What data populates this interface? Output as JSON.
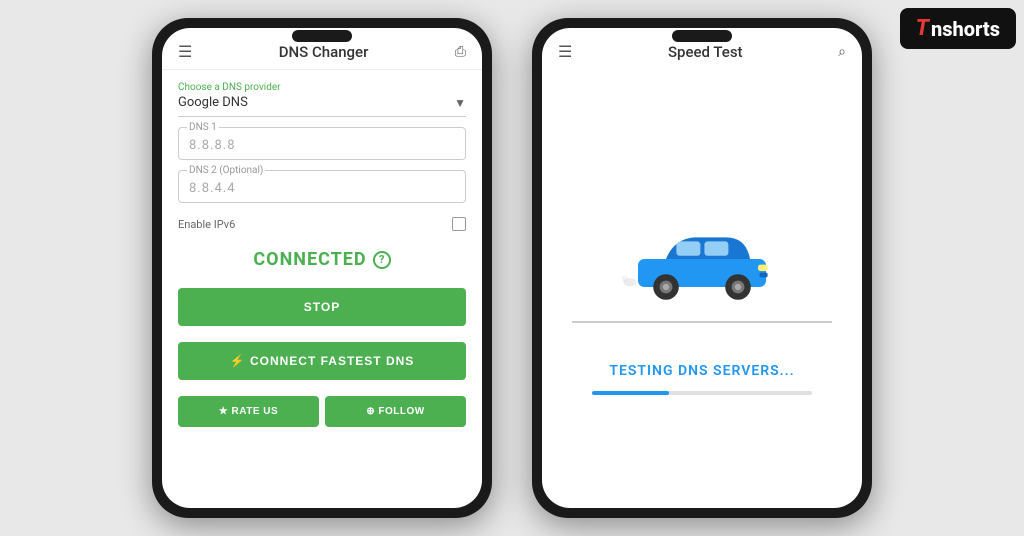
{
  "scene": {
    "background": "#e8e8e8"
  },
  "phone1": {
    "header": {
      "menu_icon": "☰",
      "title": "DNS Changer",
      "share_icon": "⎙"
    },
    "dns_provider": {
      "label": "Choose a DNS provider",
      "value": "Google DNS"
    },
    "dns1": {
      "label": "DNS 1",
      "placeholder": "8.8.8.8"
    },
    "dns2": {
      "label": "DNS 2 (Optional)",
      "placeholder": "8.8.4.4"
    },
    "ipv6": {
      "label": "Enable IPv6"
    },
    "status": {
      "text": "CONNECTED",
      "info": "?"
    },
    "buttons": {
      "stop": "STOP",
      "connect": "⚡ CONNECT FASTEST DNS",
      "rate": "★ RATE US",
      "follow": "⊕ FOLLOW"
    }
  },
  "phone2": {
    "header": {
      "menu_icon": "☰",
      "title": "Speed Test",
      "search_icon": "⌕"
    },
    "testing_text": "TESTING DNS SERVERS...",
    "progress_percent": 35
  },
  "badge": {
    "brand": "Tnshorts"
  }
}
